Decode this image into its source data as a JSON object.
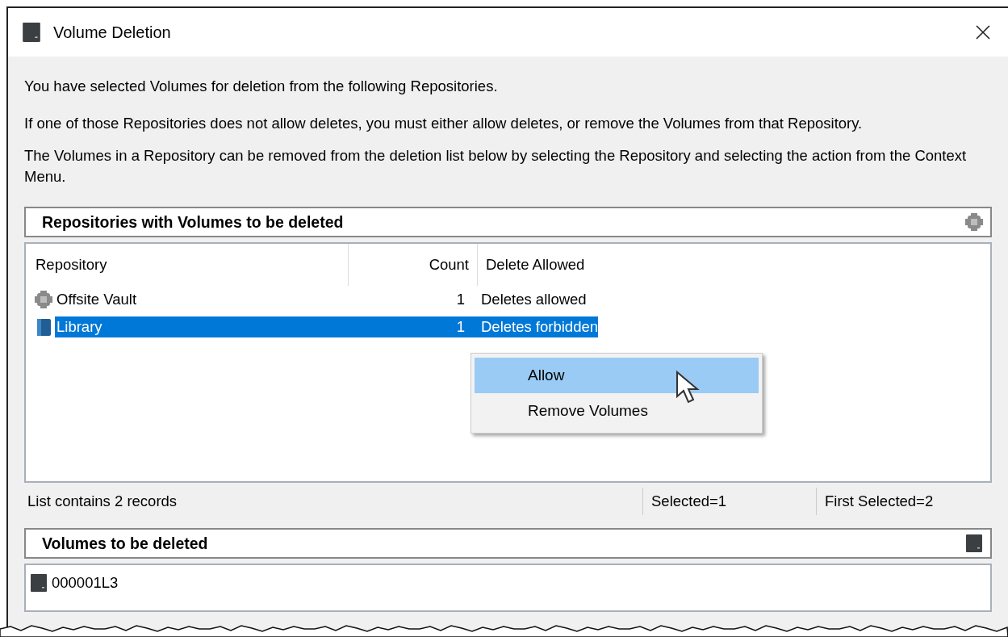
{
  "window": {
    "title": "Volume Deletion"
  },
  "messages": [
    "You have selected Volumes for deletion from the following Repositories.",
    "If one of those Repositories does not allow deletes, you must either allow deletes, or remove the Volumes from that Repository.",
    "The Volumes in a Repository can be removed from the deletion list below by selecting the Repository and selecting the action from the Context Menu."
  ],
  "repositories_panel": {
    "title": "Repositories with Volumes to be deleted",
    "columns": [
      "Repository",
      "Count",
      "Delete Allowed"
    ],
    "rows": [
      {
        "kind": "vault",
        "repository": "Offsite Vault",
        "count": "1",
        "delete_allowed": "Deletes allowed",
        "selected": false
      },
      {
        "kind": "library",
        "repository": "Library",
        "count": "1",
        "delete_allowed": "Deletes forbidden",
        "selected": true
      }
    ],
    "status_bar": [
      "List contains 2 records",
      "Selected=1",
      "First Selected=2"
    ]
  },
  "context_menu": [
    {
      "label": "Allow",
      "selected": true
    },
    {
      "label": "Remove Volumes",
      "selected": false
    }
  ],
  "volumes_panel": {
    "title": "Volumes to be deleted",
    "rows": [
      {
        "name": "000001L3"
      }
    ]
  }
}
